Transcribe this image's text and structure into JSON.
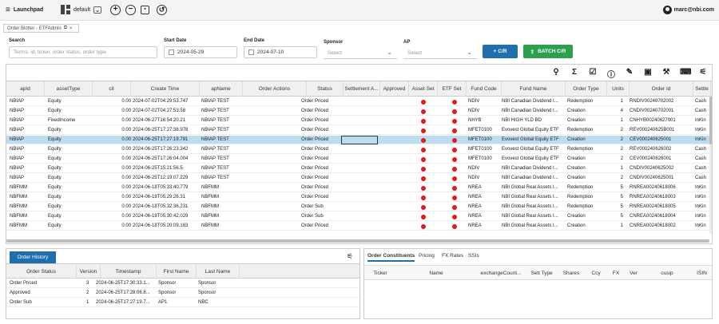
{
  "topbar": {
    "menu_label": "Launchpad",
    "layout_value": "default",
    "user": "marc@nbi.com"
  },
  "doctab": {
    "title": "Order Blotter - ETFAdmin"
  },
  "filters": {
    "search": {
      "label": "Search",
      "placeholder": "Terms: id, ticker, order status, order type"
    },
    "start_date": {
      "label": "Start Date",
      "value": "2024-05-29"
    },
    "end_date": {
      "label": "End Date",
      "value": "2024-07-10"
    },
    "sponsor": {
      "label": "Sponsor",
      "placeholder": "Select"
    },
    "ap": {
      "label": "AP",
      "placeholder": "Select"
    },
    "cr_button": "+ C/R",
    "batch_button": "BATCH C/R"
  },
  "grid": {
    "toolbar_icons": [
      "search-icon",
      "sigma-icon",
      "checkbox-icon",
      "info-icon",
      "edit-icon",
      "save-icon",
      "wrench-icon",
      "keyboard-icon",
      "clear-filter-icon"
    ],
    "columns": [
      "apId",
      "assetType",
      "cil",
      "Create Time",
      "apName",
      "Order Actions",
      "Status",
      "Settlement A...",
      "Approved",
      "Asset Set",
      "ETF Set",
      "Fund Code",
      "Fund Name",
      "Order Type",
      "Units",
      "Order Id",
      "Settle"
    ],
    "rows": [
      {
        "apId": "NBIAP",
        "assetType": "Equity",
        "cil": "0.00",
        "createTime": "2024-07-02T04:29:53.747",
        "apName": "NBIAP TEST",
        "status": "Order Priced",
        "fundCode": "NDIV",
        "fundName": "NBI Canadian Dividend I...",
        "orderType": "Redemption",
        "units": "1",
        "orderId": "RNDIV00240702002",
        "settle": "Cash"
      },
      {
        "apId": "NBIAP",
        "assetType": "Equity",
        "cil": "0.00",
        "createTime": "2024-07-02T04:27:53.58",
        "apName": "NBIAP TEST",
        "status": "Order Priced",
        "fundCode": "NDIV",
        "fundName": "NBI Canadian Dividend I...",
        "orderType": "Creation",
        "units": "4",
        "orderId": "CNDIV00240702001",
        "settle": "Cash"
      },
      {
        "apId": "NBIAP",
        "assetType": "FixedIncome",
        "cil": "0.00",
        "createTime": "2024-06-27T16:54:20.21",
        "apName": "NBIAP TEST",
        "status": "Order Priced",
        "fundCode": "NHYB",
        "fundName": "NBI HIGH YLD BD",
        "orderType": "Creation",
        "units": "1",
        "orderId": "CNHYB00240627001",
        "settle": "InKin"
      },
      {
        "apId": "NBIAP",
        "assetType": "Equity",
        "cil": "0.00",
        "createTime": "2024-06-25T17:27:38.978",
        "apName": "NBIAP TEST",
        "status": "Order Priced",
        "fundCode": "MFET0100",
        "fundName": "Evovest Global Equity ETF",
        "orderType": "Redemption",
        "units": "2",
        "orderId": "REV000240625B001",
        "settle": "InKin"
      },
      {
        "apId": "NBIAP",
        "assetType": "Equity",
        "cil": "0.00",
        "createTime": "2024-06-25T17:27:19.791",
        "apName": "NBIAP TEST",
        "status": "Order Priced",
        "fundCode": "MFET0100",
        "fundName": "Evovest Global Equity ETF",
        "orderType": "Creation",
        "units": "2",
        "orderId": "CEV000240625001",
        "settle": "InKin"
      },
      {
        "apId": "NBIAP",
        "assetType": "Equity",
        "cil": "0.00",
        "createTime": "2024-06-25T17:26:23.342",
        "apName": "NBIAP TEST",
        "status": "Order Priced",
        "fundCode": "MFET0100",
        "fundName": "Evovest Global Equity ETF",
        "orderType": "Redemption",
        "units": "2",
        "orderId": "REV000240626002",
        "settle": "Cash"
      },
      {
        "apId": "NBIAP",
        "assetType": "Equity",
        "cil": "0.00",
        "createTime": "2024-06-25T17:26:04.004",
        "apName": "NBIAP TEST",
        "status": "Order Priced",
        "fundCode": "MFET0100",
        "fundName": "Evovest Global Equity ETF",
        "orderType": "Creation",
        "units": "2",
        "orderId": "CEV000240626001",
        "settle": "Cash"
      },
      {
        "apId": "NBIAP",
        "assetType": "Equity",
        "cil": "0.00",
        "createTime": "2024-06-25T15:21:56.5",
        "apName": "NBIAP TEST",
        "status": "Order Priced",
        "fundCode": "NDIV",
        "fundName": "NBI Canadian Dividend I...",
        "orderType": "Creation",
        "units": "1",
        "orderId": "CNDIV00240625002",
        "settle": "Cash"
      },
      {
        "apId": "NBIAP",
        "assetType": "Equity",
        "cil": "0.00",
        "createTime": "2024-06-25T12:19:07.229",
        "apName": "NBIAP TEST",
        "status": "Order Priced",
        "fundCode": "NDIV",
        "fundName": "NBI Canadian Dividend I...",
        "orderType": "Creation",
        "units": "2",
        "orderId": "CNDIV00240625001",
        "settle": "Cash"
      },
      {
        "apId": "NBFMM",
        "assetType": "Equity",
        "cil": "0.00",
        "createTime": "2024-06-18T05:33:40.779",
        "apName": "NBFMM",
        "status": "Order Priced",
        "fundCode": "NREA",
        "fundName": "NBI Global Real Assets I...",
        "orderType": "Redemption",
        "units": "5",
        "orderId": "RNREA00240618006",
        "settle": "InKin"
      },
      {
        "apId": "NBFMM",
        "assetType": "Equity",
        "cil": "0.00",
        "createTime": "2024-06-18T05:29:26.31",
        "apName": "NBFMM",
        "status": "Order Priced",
        "fundCode": "NREA",
        "fundName": "NBI Global Real Assets I...",
        "orderType": "Redemption",
        "units": "5",
        "orderId": "RNREA00240618003",
        "settle": "InKin"
      },
      {
        "apId": "NBFMM",
        "assetType": "Equity",
        "cil": "0.00",
        "createTime": "2024-06-18T05:32:36.231",
        "apName": "NBFMM",
        "status": "Order Sub",
        "fundCode": "NREA",
        "fundName": "NBI Global Real Assets I...",
        "orderType": "Redemption",
        "units": "5",
        "orderId": "RNREA00240618005",
        "settle": "InKin"
      },
      {
        "apId": "NBFMM",
        "assetType": "Equity",
        "cil": "0.00",
        "createTime": "2024-06-18T05:30:42.029",
        "apName": "NBFMM",
        "status": "Order Sub",
        "fundCode": "NREA",
        "fundName": "NBI Global Real Assets I...",
        "orderType": "Creation",
        "units": "5",
        "orderId": "CNREA00240618004",
        "settle": "InKin"
      },
      {
        "apId": "NBFMM",
        "assetType": "Equity",
        "cil": "0.00",
        "createTime": "2024-06-18T05:20:09.163",
        "apName": "NBFMM",
        "status": "Order Priced",
        "fundCode": "NREA",
        "fundName": "NBI Global Real Assets I...",
        "orderType": "Creation",
        "units": "1",
        "orderId": "CNREA00240618002",
        "settle": "InKin"
      }
    ]
  },
  "history": {
    "tab_label": "Order History",
    "columns": [
      "Order Status",
      "Version",
      "Timestamp",
      "First Name",
      "Last Name"
    ],
    "rows": [
      {
        "status": "Order Priced",
        "version": "3",
        "timestamp": "2024-06-25T17:30:33.1...",
        "first": "Sponsor",
        "last": "Sponsor"
      },
      {
        "status": "Approved",
        "version": "2",
        "timestamp": "2024-06-25T17:28:06.8...",
        "first": "Sponsor",
        "last": "Sponsor"
      },
      {
        "status": "Order Sub",
        "version": "1",
        "timestamp": "2024-06-25T17:27:19.7...",
        "first": "AP1",
        "last": "NBC"
      }
    ]
  },
  "constituents": {
    "tabs": [
      "Order Constituents",
      "Pricing",
      "FX Rates",
      "SSIs"
    ],
    "columns": [
      "Ticker",
      "Name",
      "exchangeCount...",
      "Sett Type",
      "Shares",
      "Ccy",
      "FX",
      "Ver",
      "cusip",
      "ISIN"
    ]
  },
  "colors": {
    "accent": "#1f6fad",
    "batch": "#2e9e4f",
    "selected_row": "#bcdcef",
    "status_dot": "#e3191c"
  }
}
